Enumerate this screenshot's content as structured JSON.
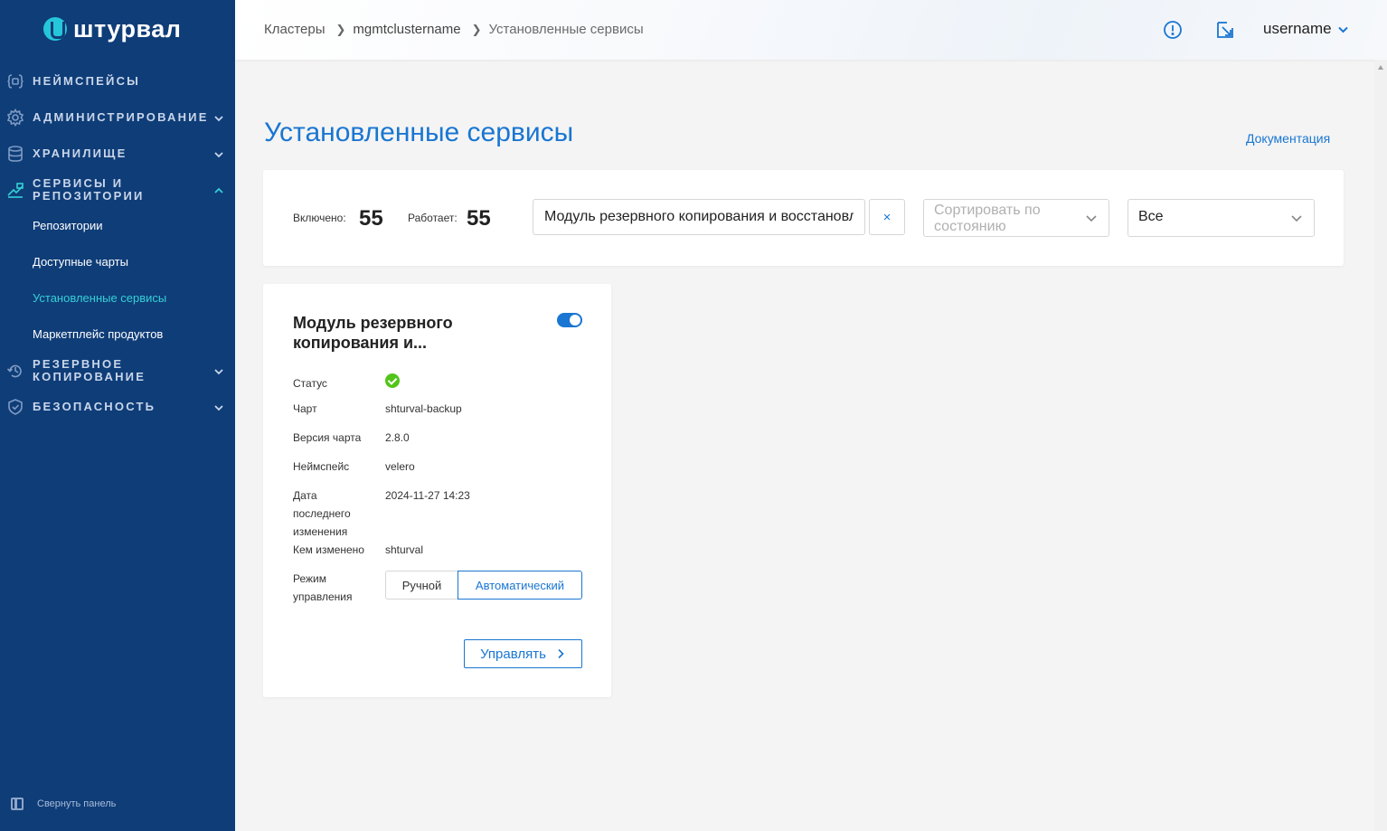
{
  "app": {
    "logo_text": "штурвал"
  },
  "sidebar": {
    "items": [
      {
        "label": "Неймспейсы",
        "icon": "braces-icon"
      },
      {
        "label": "Администрирование",
        "icon": "gear-icon"
      },
      {
        "label": "Хранилище",
        "icon": "database-icon"
      },
      {
        "label": "Сервисы и репозитории",
        "icon": "services-icon"
      },
      {
        "label": "Резервное копирование",
        "icon": "backup-icon"
      },
      {
        "label": "Безопасность",
        "icon": "shield-icon"
      }
    ],
    "sub_items": [
      {
        "label": "Репозитории"
      },
      {
        "label": "Доступные чарты"
      },
      {
        "label": "Установленные сервисы",
        "active": true
      },
      {
        "label": "Маркетплейс продуктов"
      }
    ],
    "collapse_label": "Свернуть панель"
  },
  "header": {
    "breadcrumbs": [
      "Кластеры",
      "mgmtclustername",
      "Установленные сервисы"
    ],
    "username": "username"
  },
  "page": {
    "title": "Установленные сервисы",
    "doc_link": "Документация"
  },
  "filters": {
    "enabled_label": "Включено:",
    "enabled_value": "55",
    "running_label": "Работает:",
    "running_value": "55",
    "search_value": "Модуль резервного копирования и восстановления",
    "clear_symbol": "×",
    "sort_placeholder": "Сортировать по состоянию",
    "filter_value": "Все"
  },
  "card": {
    "title": "Модуль резервного копирования и...",
    "enabled": true,
    "status_label": "Статус",
    "status": "ok",
    "chart_label": "Чарт",
    "chart_value": "shturval-backup",
    "version_label": "Версия чарта",
    "version_value": "2.8.0",
    "namespace_label": "Неймспейс",
    "namespace_value": "velero",
    "modified_label_1": "Дата",
    "modified_label_2": "последнего",
    "modified_label_3": "изменения",
    "modified_value": "2024-11-27 14:23",
    "modified_by_label": "Кем изменено",
    "modified_by_value": "shturval",
    "mode_label_1": "Режим",
    "mode_label_2": "управления",
    "mode_manual": "Ручной",
    "mode_auto": "Автоматический",
    "mode_selected": "Автоматический",
    "manage_button": "Управлять"
  },
  "colors": {
    "sidebar_bg": "#0f3d78",
    "accent": "#1976d2",
    "active_sub": "#35d0d6",
    "status_ok": "#52c41a"
  }
}
